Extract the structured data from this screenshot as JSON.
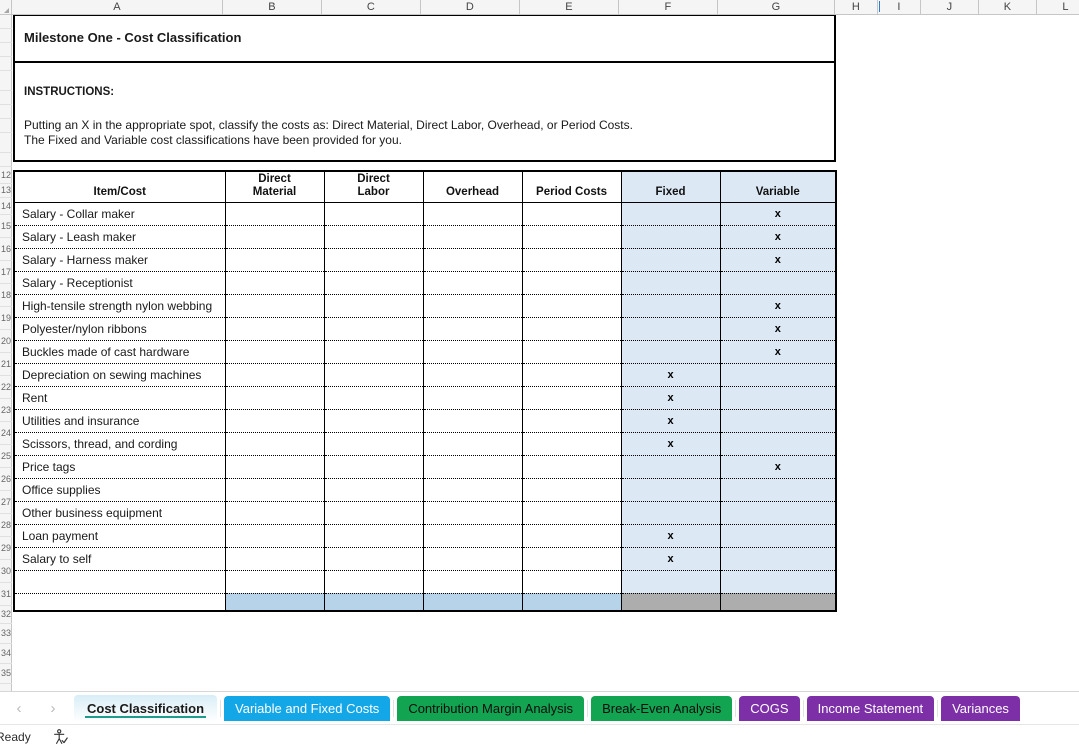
{
  "app": {
    "status_text": "Ready",
    "accessibility_icon": "accessibility-checker-icon"
  },
  "colors": {
    "shaded_cell": "#dce9f5",
    "total_blue": "#b7d3ea",
    "total_gray": "#adadad",
    "tab_blue": "#14a7e8",
    "tab_green": "#13a452",
    "tab_purple": "#7d2fa8",
    "active_tab_underline": "#1f9c8e"
  },
  "column_headers": [
    "A",
    "B",
    "C",
    "D",
    "E",
    "F",
    "G",
    "H",
    "I",
    "J",
    "K",
    "L"
  ],
  "row_numbers": [
    "",
    "",
    "",
    "",
    "",
    "",
    "",
    "",
    "",
    "",
    "12",
    "13",
    "14",
    "15",
    "16",
    "17",
    "18",
    "19",
    "20",
    "21",
    "22",
    "23",
    "24",
    "25",
    "26",
    "27",
    "28",
    "29",
    "30",
    "31",
    "32",
    "33",
    "34",
    "35"
  ],
  "sheet": {
    "title": "Milestone One - Cost Classification",
    "instructions_label": "INSTRUCTIONS:",
    "instructions_line1": "Putting an X in the appropriate spot, classify the costs as:  Direct Material, Direct Labor, Overhead, or Period Costs.",
    "instructions_line2": "The Fixed and Variable cost classifications have been provided for you."
  },
  "table": {
    "headers": [
      "Item/Cost",
      "Direct\nMaterial",
      "Direct\nLabor",
      "Overhead",
      "Period Costs",
      "Fixed",
      "Variable"
    ],
    "header_lines": [
      [
        "Item/Cost"
      ],
      [
        "Direct",
        "Material"
      ],
      [
        "Direct",
        "Labor"
      ],
      [
        "Overhead"
      ],
      [
        "Period Costs"
      ],
      [
        "Fixed"
      ],
      [
        "Variable"
      ]
    ],
    "mark": "x",
    "rows": [
      {
        "item": "Salary - Collar maker",
        "direct_material": "",
        "direct_labor": "",
        "overhead": "",
        "period_costs": "",
        "fixed": "",
        "variable": "x"
      },
      {
        "item": "Salary - Leash maker",
        "direct_material": "",
        "direct_labor": "",
        "overhead": "",
        "period_costs": "",
        "fixed": "",
        "variable": "x"
      },
      {
        "item": "Salary - Harness maker",
        "direct_material": "",
        "direct_labor": "",
        "overhead": "",
        "period_costs": "",
        "fixed": "",
        "variable": "x"
      },
      {
        "item": "Salary - Receptionist",
        "direct_material": "",
        "direct_labor": "",
        "overhead": "",
        "period_costs": "",
        "fixed": "",
        "variable": ""
      },
      {
        "item": "High-tensile strength nylon webbing",
        "direct_material": "",
        "direct_labor": "",
        "overhead": "",
        "period_costs": "",
        "fixed": "",
        "variable": "x"
      },
      {
        "item": "Polyester/nylon ribbons",
        "direct_material": "",
        "direct_labor": "",
        "overhead": "",
        "period_costs": "",
        "fixed": "",
        "variable": "x"
      },
      {
        "item": "Buckles made of cast hardware",
        "direct_material": "",
        "direct_labor": "",
        "overhead": "",
        "period_costs": "",
        "fixed": "",
        "variable": "x"
      },
      {
        "item": "Depreciation on sewing machines",
        "direct_material": "",
        "direct_labor": "",
        "overhead": "",
        "period_costs": "",
        "fixed": "x",
        "variable": ""
      },
      {
        "item": "Rent",
        "direct_material": "",
        "direct_labor": "",
        "overhead": "",
        "period_costs": "",
        "fixed": "x",
        "variable": ""
      },
      {
        "item": "Utilities and insurance",
        "direct_material": "",
        "direct_labor": "",
        "overhead": "",
        "period_costs": "",
        "fixed": "x",
        "variable": ""
      },
      {
        "item": "Scissors, thread, and cording",
        "direct_material": "",
        "direct_labor": "",
        "overhead": "",
        "period_costs": "",
        "fixed": "x",
        "variable": ""
      },
      {
        "item": "Price tags",
        "direct_material": "",
        "direct_labor": "",
        "overhead": "",
        "period_costs": "",
        "fixed": "",
        "variable": "x"
      },
      {
        "item": "Office supplies",
        "direct_material": "",
        "direct_labor": "",
        "overhead": "",
        "period_costs": "",
        "fixed": "",
        "variable": ""
      },
      {
        "item": "Other business equipment",
        "direct_material": "",
        "direct_labor": "",
        "overhead": "",
        "period_costs": "",
        "fixed": "",
        "variable": ""
      },
      {
        "item": "Loan payment",
        "direct_material": "",
        "direct_labor": "",
        "overhead": "",
        "period_costs": "",
        "fixed": "x",
        "variable": ""
      },
      {
        "item": "Salary to self",
        "direct_material": "",
        "direct_labor": "",
        "overhead": "",
        "period_costs": "",
        "fixed": "x",
        "variable": ""
      },
      {
        "item": "",
        "direct_material": "",
        "direct_labor": "",
        "overhead": "",
        "period_costs": "",
        "fixed": "",
        "variable": ""
      }
    ],
    "total_row": {
      "item": "",
      "direct_material": "",
      "direct_labor": "",
      "overhead": "",
      "period_costs": "",
      "fixed": "",
      "variable": ""
    }
  },
  "tabs": {
    "prev_label": "‹",
    "next_label": "›",
    "items": [
      {
        "label": "Cost Classification",
        "style": "active"
      },
      {
        "label": "Variable and Fixed Costs",
        "style": "blue"
      },
      {
        "label": "Contribution Margin Analysis",
        "style": "green"
      },
      {
        "label": "Break-Even Analysis",
        "style": "green"
      },
      {
        "label": "COGS",
        "style": "purple"
      },
      {
        "label": "Income Statement",
        "style": "purple"
      },
      {
        "label": "Variances",
        "style": "purple"
      }
    ]
  }
}
